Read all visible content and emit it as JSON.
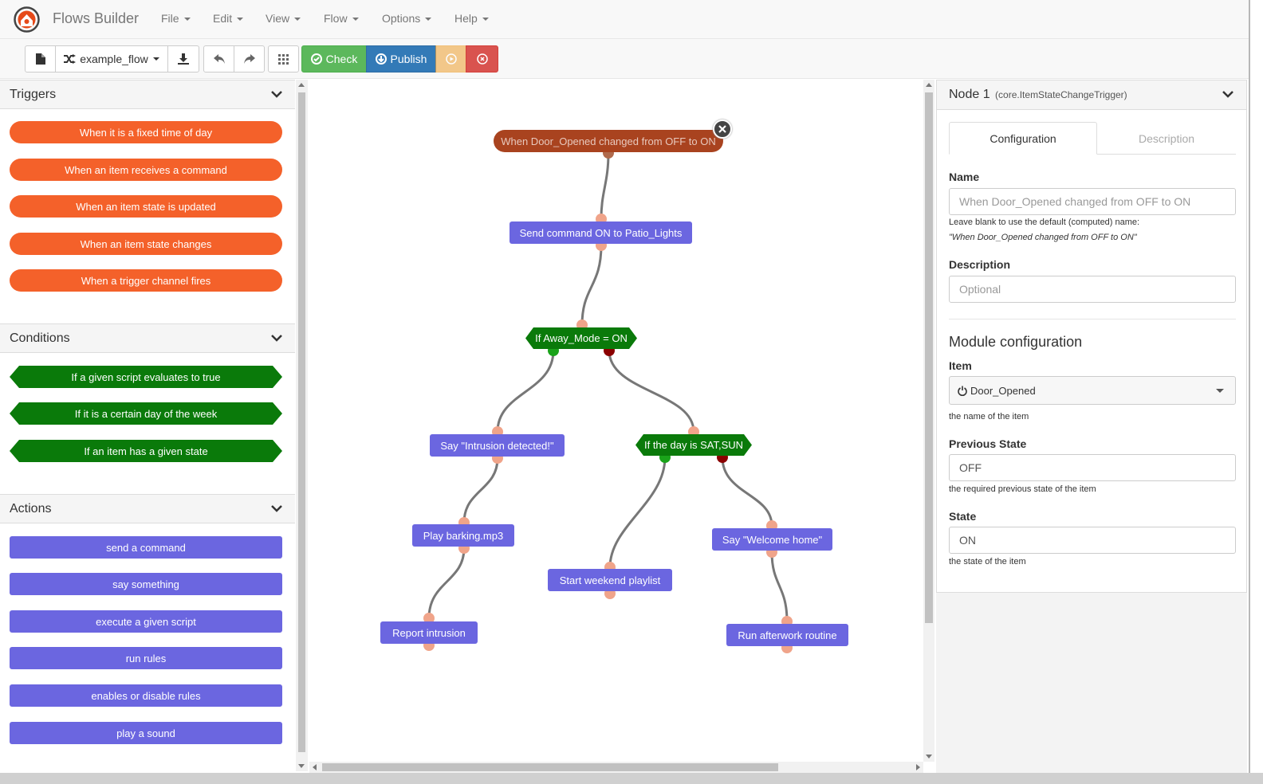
{
  "app": {
    "title": "Flows Builder"
  },
  "menu": [
    "File",
    "Edit",
    "View",
    "Flow",
    "Options",
    "Help"
  ],
  "toolbar": {
    "flow_name": "example_flow",
    "check_label": "Check",
    "publish_label": "Publish"
  },
  "palette": {
    "triggers": {
      "title": "Triggers",
      "items": [
        "When it is a fixed time of day",
        "When an item receives a command",
        "When an item state is updated",
        "When an item state changes",
        "When a trigger channel fires"
      ]
    },
    "conditions": {
      "title": "Conditions",
      "items": [
        "If a given script evaluates to true",
        "If it is a certain day of the week",
        "If an item has a given state"
      ]
    },
    "actions": {
      "title": "Actions",
      "items": [
        "send a command",
        "say something",
        "execute a given script",
        "run rules",
        "enables or disable rules",
        "play a sound"
      ]
    }
  },
  "flow": {
    "nodes": [
      {
        "id": "n1",
        "label": "When Door_Opened changed from OFF to ON",
        "kind": "trigger"
      },
      {
        "id": "n2",
        "label": "Send command ON to Patio_Lights",
        "kind": "action"
      },
      {
        "id": "n3",
        "label": "If Away_Mode = ON",
        "kind": "condition"
      },
      {
        "id": "n4",
        "label": "Say \"Intrusion detected!\"",
        "kind": "action"
      },
      {
        "id": "n5",
        "label": "If the day is SAT,SUN",
        "kind": "condition"
      },
      {
        "id": "n6",
        "label": "Play barking.mp3",
        "kind": "action"
      },
      {
        "id": "n7",
        "label": "Start weekend playlist",
        "kind": "action"
      },
      {
        "id": "n8",
        "label": "Say \"Welcome home\"",
        "kind": "action"
      },
      {
        "id": "n9",
        "label": "Report intrusion",
        "kind": "action"
      },
      {
        "id": "n10",
        "label": "Run afterwork routine",
        "kind": "action"
      }
    ]
  },
  "inspector": {
    "node_title": "Node 1",
    "node_type": "(core.ItemStateChangeTrigger)",
    "tabs": [
      "Configuration",
      "Description"
    ],
    "name_label": "Name",
    "name_placeholder": "When Door_Opened changed from OFF to ON",
    "name_help": "Leave blank to use the default (computed) name:",
    "name_default": "\"When Door_Opened changed from OFF to ON\"",
    "description_label": "Description",
    "description_placeholder": "Optional",
    "module_title": "Module configuration",
    "item_label": "Item",
    "item_value": "Door_Opened",
    "item_help": "the name of the item",
    "prev_label": "Previous State",
    "prev_value": "OFF",
    "prev_help": "the required previous state of the item",
    "state_label": "State",
    "state_value": "ON",
    "state_help": "the state of the item"
  },
  "colors": {
    "trigger": "#f4612a",
    "trigger_selected": "#a9431f",
    "condition": "#0a7a0a",
    "action": "#6b66e0",
    "port": "#f0a48a",
    "port_true": "#1aa31a",
    "port_false": "#8b0000",
    "check": "#5cb85c",
    "publish": "#337ab7",
    "run": "#f0ad4e",
    "stop": "#d9534f"
  },
  "icons": [
    "openhab-logo-icon",
    "new-file-icon",
    "shuffle-icon",
    "download-icon",
    "undo-icon",
    "redo-icon",
    "grid-icon",
    "check-circle-icon",
    "upload-circle-icon",
    "play-circle-icon",
    "stop-circle-icon",
    "chevron-down-icon",
    "power-icon",
    "close-icon"
  ]
}
